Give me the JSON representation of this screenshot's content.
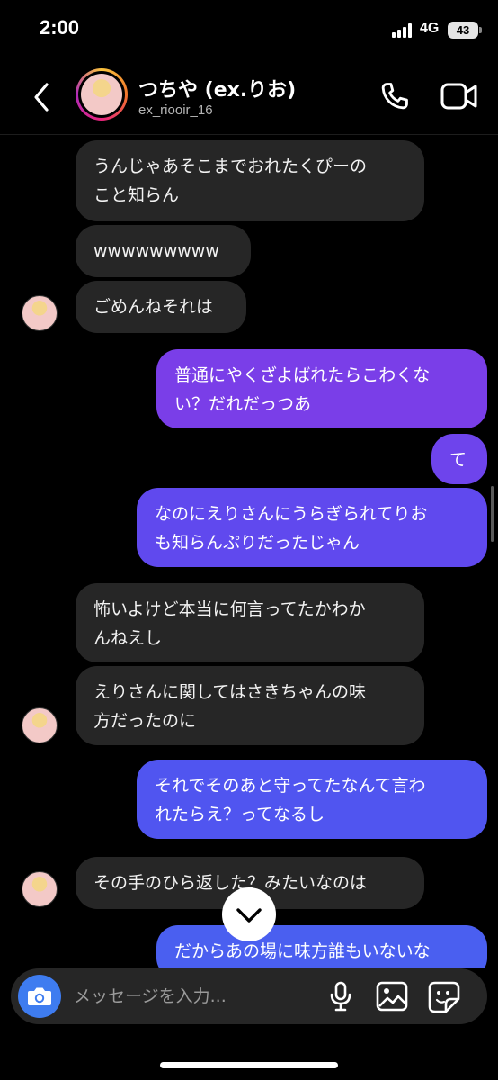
{
  "status_bar": {
    "time": "2:00",
    "network": "4G",
    "battery": "43"
  },
  "header": {
    "name": "つちや (ex.りお)",
    "handle": "ex_riooir_16"
  },
  "colors": {
    "sent_top": "#7a3ee8",
    "sent_bottom": "#4a5ff0",
    "received": "#262626",
    "accent": "#3e7cf0"
  },
  "messages": [
    {
      "side": "received",
      "lines": [
        "うんじゃあそこまでおれたくぴーの",
        "こと知らん"
      ]
    },
    {
      "side": "received",
      "lines": [
        "wwwwwwwww"
      ]
    },
    {
      "side": "received",
      "lines": [
        "ごめんねそれは"
      ]
    },
    {
      "side": "sent",
      "lines": [
        "普通にやくざよばれたらこわくな",
        "い？だれだっつあ"
      ]
    },
    {
      "side": "sent",
      "lines": [
        "て"
      ]
    },
    {
      "side": "sent",
      "lines": [
        "なのにえりさんにうらぎられてりお",
        "も知らんぷりだったじゃん"
      ]
    },
    {
      "side": "received",
      "lines": [
        "怖いよけど本当に何言ってたかわか",
        "んねえし"
      ]
    },
    {
      "side": "received",
      "lines": [
        "えりさんに関してはさきちゃんの味",
        "方だったのに"
      ]
    },
    {
      "side": "sent",
      "lines": [
        "それでそのあと守ってたなんて言わ",
        "れたらえ？ってなるし"
      ]
    },
    {
      "side": "received",
      "lines": [
        "その手のひら返した？みたいなのは"
      ]
    },
    {
      "side": "sent",
      "lines": [
        "だからあの場に味方誰もいないな"
      ]
    }
  ],
  "composer": {
    "placeholder": "メッセージを入力..."
  },
  "icons": [
    "back-arrow-icon",
    "phone-icon",
    "video-camera-icon",
    "chevron-down-icon",
    "camera-icon",
    "microphone-icon",
    "image-gallery-icon",
    "sticker-icon"
  ]
}
